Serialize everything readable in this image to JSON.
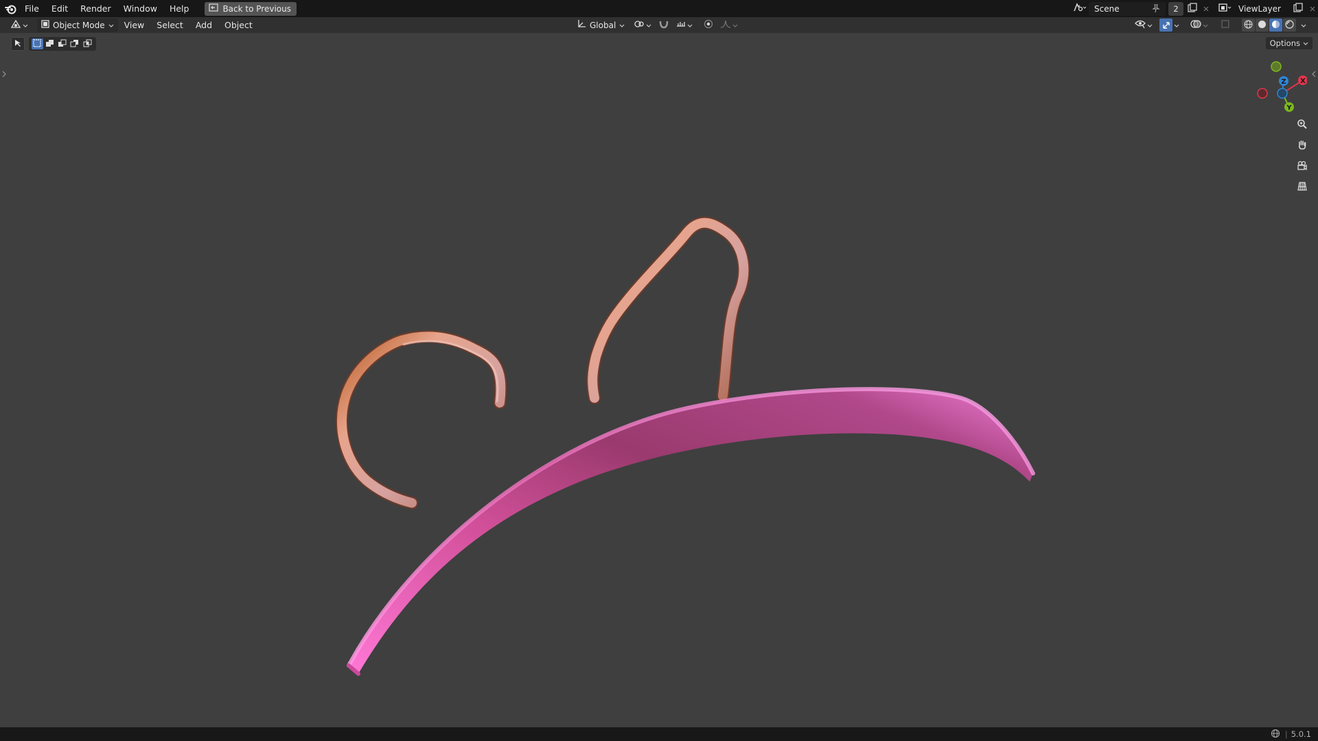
{
  "topbar": {
    "menus": [
      "File",
      "Edit",
      "Render",
      "Window",
      "Help"
    ],
    "back_button": "Back to Previous",
    "scene_name": "Scene",
    "scene_count": "2",
    "view_layer": "ViewLayer"
  },
  "header": {
    "mode": "Object Mode",
    "menus": [
      "View",
      "Select",
      "Add",
      "Object"
    ],
    "orientation": "Global"
  },
  "toolrow": {
    "options_label": "Options"
  },
  "gizmo": {
    "x_label": "X",
    "y_label": "Y",
    "z_label": "Z"
  },
  "statusbar": {
    "version": "5.0.1"
  },
  "colors": {
    "viewport_bg": "#3f3f3f",
    "headband": "#e060b0",
    "ears": "#c98a78",
    "accent_blue": "#4772b3",
    "axis_x": "#e0364c",
    "axis_y": "#7bb821",
    "axis_z": "#2f86d6"
  }
}
